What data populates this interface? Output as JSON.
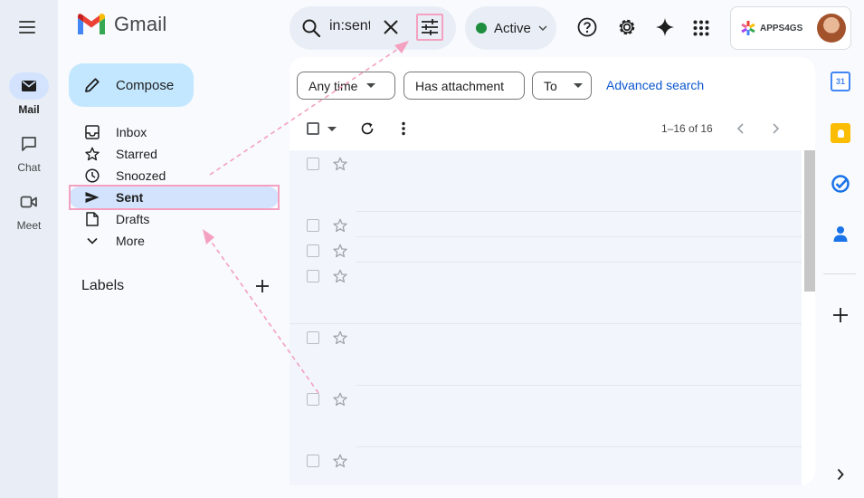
{
  "app": {
    "name": "Gmail"
  },
  "rail": {
    "items": [
      {
        "label": "Mail",
        "icon": "mail-icon",
        "active": true
      },
      {
        "label": "Chat",
        "icon": "chat-icon",
        "active": false
      },
      {
        "label": "Meet",
        "icon": "meet-icon",
        "active": false
      }
    ]
  },
  "search": {
    "query": "in:sent"
  },
  "status": {
    "label": "Active",
    "color": "#1e8e3e"
  },
  "account": {
    "name": "APPS4GS"
  },
  "compose": {
    "label": "Compose"
  },
  "nav": {
    "items": [
      {
        "label": "Inbox",
        "icon": "inbox-icon"
      },
      {
        "label": "Starred",
        "icon": "star-icon"
      },
      {
        "label": "Snoozed",
        "icon": "clock-icon"
      },
      {
        "label": "Sent",
        "icon": "send-icon",
        "active": true
      },
      {
        "label": "Drafts",
        "icon": "draft-icon"
      },
      {
        "label": "More",
        "icon": "chevron-down-icon"
      }
    ]
  },
  "labels": {
    "title": "Labels"
  },
  "filters": {
    "any_time": "Any time",
    "has_attachment": "Has attachment",
    "to": "To",
    "advanced": "Advanced search"
  },
  "pagination": {
    "range": "1–16 of 16"
  },
  "colors": {
    "accent": "#0b57d0",
    "highlight": "#f4a0c0",
    "compose_bg": "#c2e7ff",
    "active_nav": "#d3e3fd"
  }
}
